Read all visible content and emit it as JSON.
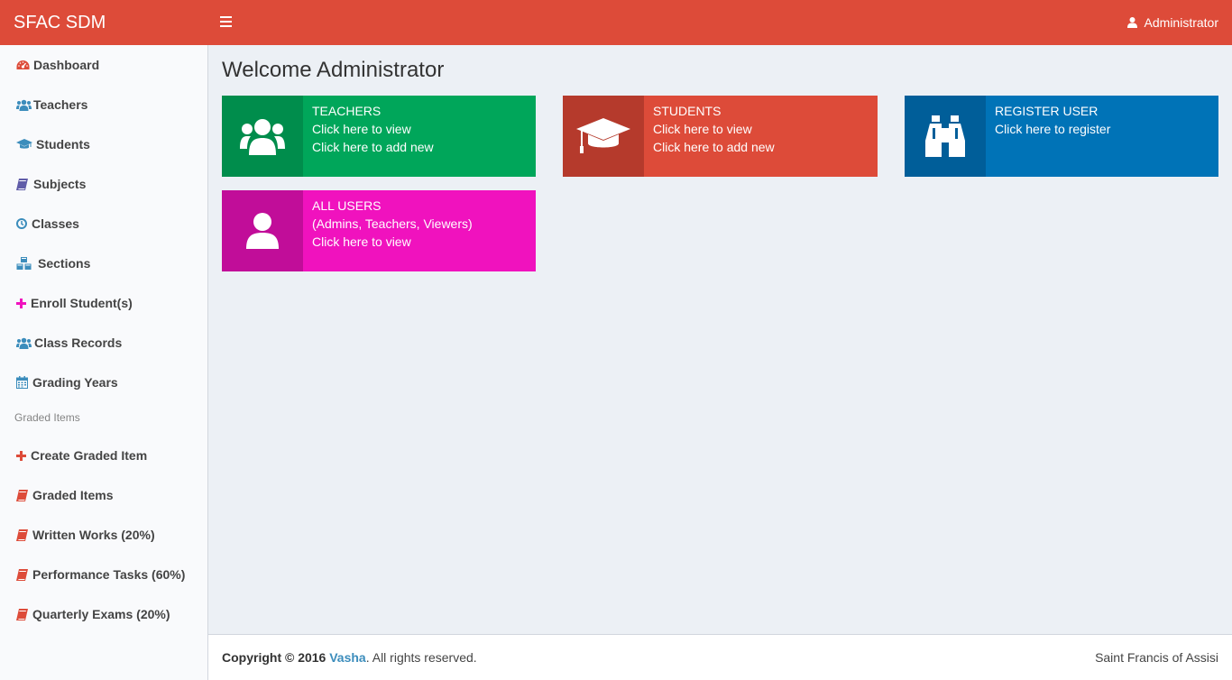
{
  "header": {
    "brand": "SFAC SDM",
    "user_label": "Administrator"
  },
  "sidebar": {
    "items": [
      {
        "label": "Dashboard",
        "icon": "dashboard-icon",
        "color": "#dd4b39"
      },
      {
        "label": "Teachers",
        "icon": "users-icon",
        "color": "#3c8dbc"
      },
      {
        "label": "Students",
        "icon": "graduation-cap-icon",
        "color": "#3c8dbc"
      },
      {
        "label": "Subjects",
        "icon": "book-icon",
        "color": "#605ca8"
      },
      {
        "label": "Classes",
        "icon": "clock-icon",
        "color": "#3c8dbc"
      },
      {
        "label": "Sections",
        "icon": "cubes-icon",
        "color": "#3c8dbc"
      },
      {
        "label": "Enroll Student(s)",
        "icon": "plus-icon",
        "color": "#f012be"
      },
      {
        "label": "Class Records",
        "icon": "users-icon",
        "color": "#3c8dbc"
      },
      {
        "label": "Grading Years",
        "icon": "calendar-icon",
        "color": "#3c8dbc"
      }
    ],
    "section_header": "Graded Items",
    "graded_items": [
      {
        "label": "Create Graded Item",
        "icon": "plus-icon",
        "color": "#dd4b39"
      },
      {
        "label": "Graded Items",
        "icon": "book-icon",
        "color": "#dd4b39"
      },
      {
        "label": "Written Works (20%)",
        "icon": "book-icon",
        "color": "#dd4b39"
      },
      {
        "label": "Performance Tasks (60%)",
        "icon": "book-icon",
        "color": "#dd4b39"
      },
      {
        "label": "Quarterly Exams (20%)",
        "icon": "book-icon",
        "color": "#dd4b39"
      }
    ]
  },
  "main": {
    "title": "Welcome Administrator",
    "tiles": [
      {
        "title": "TEACHERS",
        "line1": "Click here to view",
        "line2": "Click here to add new",
        "icon": "users-icon",
        "color": "#00a65a",
        "icon_bg": "#008d4c"
      },
      {
        "title": "STUDENTS",
        "line1": "Click here to view",
        "line2": "Click here to add new",
        "icon": "graduation-cap-icon",
        "color": "#dd4b39",
        "icon_bg": "#b53a2c"
      },
      {
        "title": "REGISTER USER",
        "line1": "Click here to register",
        "icon": "binoculars-icon",
        "color": "#0073b7",
        "icon_bg": "#005e99"
      },
      {
        "title": "ALL USERS",
        "line1": "(Admins, Teachers, Viewers)",
        "line2": "Click here to view",
        "icon": "user-icon",
        "color": "#f012be",
        "icon_bg": "#c10d99"
      }
    ]
  },
  "footer": {
    "copyright_prefix": "Copyright © 2016",
    "author": "Vasha",
    "rights": ". All rights reserved.",
    "org": "Saint Francis of Assisi"
  }
}
